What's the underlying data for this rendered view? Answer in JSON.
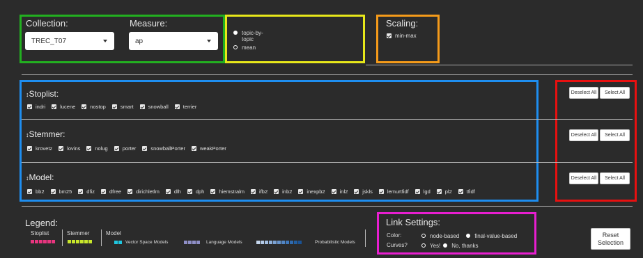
{
  "collection": {
    "label": "Collection:",
    "value": "TREC_T07"
  },
  "measure": {
    "label": "Measure:",
    "value": "ap"
  },
  "view": {
    "options": [
      {
        "label": "topic-by-topic",
        "selected": true
      },
      {
        "label": "mean",
        "selected": false
      }
    ]
  },
  "scaling": {
    "title": "Scaling:",
    "option": "min-max"
  },
  "sections": [
    {
      "title": "Stoplist:",
      "items": [
        "indri",
        "lucene",
        "nostop",
        "smart",
        "snowball",
        "terrier"
      ]
    },
    {
      "title": "Stemmer:",
      "items": [
        "krovetz",
        "lovins",
        "nolug",
        "porter",
        "snowballPorter",
        "weakPorter"
      ]
    },
    {
      "title": "Model:",
      "items": [
        "bb2",
        "bm25",
        "dfiz",
        "dfree",
        "dirichletlm",
        "dlh",
        "dph",
        "hiemstralm",
        "ifb2",
        "inb2",
        "inexpb2",
        "inl2",
        "jskls",
        "lemurtfidf",
        "lgd",
        "pl2",
        "tfidf"
      ]
    }
  ],
  "buttons": {
    "deselect": "Deselect All",
    "select": "Select All",
    "reset_line1": "Reset",
    "reset_line2": "Selection"
  },
  "legend": {
    "title": "Legend:",
    "stoplist": "Stoplist",
    "stemmer": "Stemmer",
    "model": "Model",
    "vsm": "Vector Space Models",
    "lm": "Language Models",
    "pm": "Probabilistic Models",
    "colors": {
      "stoplist": [
        "#e8357f",
        "#e8357f",
        "#e8357f",
        "#e8357f",
        "#e8357f",
        "#e8357f"
      ],
      "stemmer": [
        "#c8e62b",
        "#c8e62b",
        "#c8e62b",
        "#c8e62b",
        "#c8e62b",
        "#c8e62b"
      ],
      "vsm": [
        "#1fc7e0",
        "#1fc7e0"
      ],
      "lm": [
        "#8e8ec6",
        "#8e8ec6",
        "#8e8ec6",
        "#8e8ec6"
      ],
      "pm": [
        "#c5d6ec",
        "#b4cae6",
        "#a3bee0",
        "#8fb0da",
        "#7ba2d3",
        "#6794cc",
        "#5386c4",
        "#3f78bc",
        "#2f6aae",
        "#225ea0",
        "#1a5294"
      ]
    }
  },
  "link": {
    "title": "Link Settings:",
    "color_label": "Color:",
    "color_options": [
      {
        "label": "node-based",
        "selected": false
      },
      {
        "label": "final-value-based",
        "selected": true
      }
    ],
    "curves_label": "Curves?",
    "curves_options": [
      {
        "label": "Yes!",
        "selected": false
      },
      {
        "label": "No, thanks",
        "selected": true
      }
    ]
  },
  "accent_colors": {
    "green": "#22b020",
    "yellow": "#e8e81a",
    "orange": "#f59b1a",
    "blue": "#1e8ef0",
    "red": "#e81010",
    "magenta": "#e81ed0"
  }
}
